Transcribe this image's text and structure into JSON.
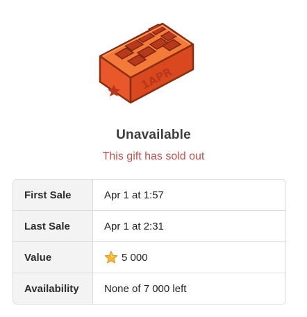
{
  "gift": {
    "image_icon": "brick-icon",
    "brick_text": "1APR"
  },
  "status": {
    "title": "Unavailable",
    "subtitle": "This gift has sold out"
  },
  "details": {
    "rows": [
      {
        "label": "First Sale",
        "value": "Apr 1 at 1:57"
      },
      {
        "label": "Last Sale",
        "value": "Apr 1 at 2:31"
      },
      {
        "label": "Value",
        "value": "5 000",
        "icon": "star-icon"
      },
      {
        "label": "Availability",
        "value": "None of 7 000 left"
      }
    ]
  },
  "colors": {
    "subtitle": "#c8504e",
    "brick": "#f26a2e",
    "star": "#f5b82e"
  }
}
